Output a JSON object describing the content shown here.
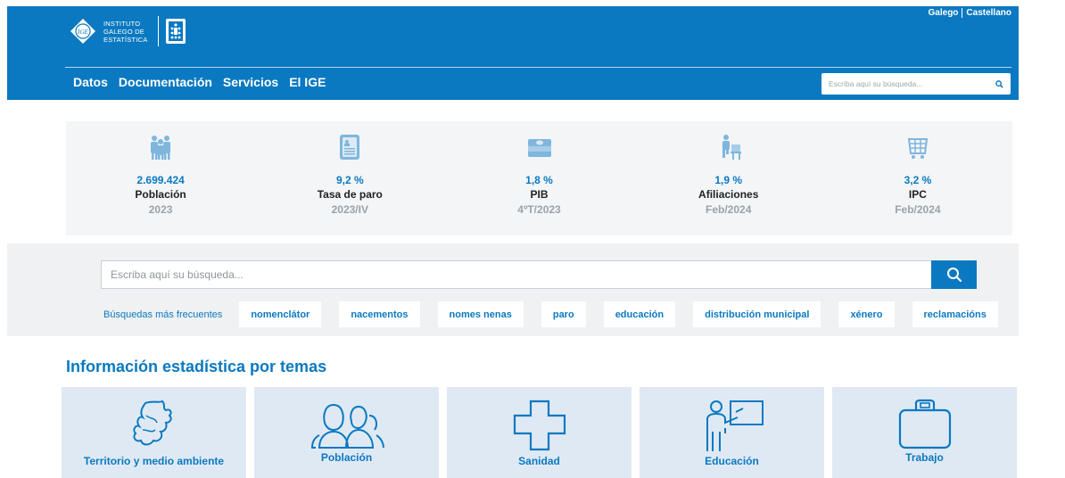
{
  "header": {
    "logo_lines": [
      "INSTITUTO",
      "GALEGO DE",
      "ESTATÍSTICA"
    ],
    "logo_mark": "IGE",
    "lang": [
      "Galego",
      "Castellano"
    ],
    "nav": [
      "Datos",
      "Documentación",
      "Servicios",
      "El IGE"
    ],
    "search_placeholder": "Escriba aquí su búsqueda..."
  },
  "stats": [
    {
      "icon": "people-icon",
      "value": "2.699.424",
      "label": "Población",
      "period": "2023"
    },
    {
      "icon": "document-icon",
      "value": "9,2 %",
      "label": "Tasa de paro",
      "period": "2023/IV"
    },
    {
      "icon": "money-icon",
      "value": "1,8 %",
      "label": "PIB",
      "period": "4ºT/2023"
    },
    {
      "icon": "worker-icon",
      "value": "1,9 %",
      "label": "Afiliaciones",
      "period": "Feb/2024"
    },
    {
      "icon": "cart-icon",
      "value": "3,2 %",
      "label": "IPC",
      "period": "Feb/2024"
    }
  ],
  "search": {
    "placeholder": "Escriba aquí su búsqueda...",
    "frequent_label": "Búsquedas más frecuentes",
    "frequent": [
      "nomenclátor",
      "nacementos",
      "nomes nenas",
      "paro",
      "educación",
      "distribución municipal",
      "xénero",
      "reclamacións"
    ]
  },
  "themes": {
    "title": "Información estadística por temas",
    "tiles": [
      "Territorio y medio ambiente",
      "Población",
      "Sanidad",
      "Educación",
      "Trabajo"
    ]
  },
  "colors": {
    "primary": "#0a79c1",
    "panel": "#f3f5f7",
    "tile": "#dfe9f4"
  }
}
